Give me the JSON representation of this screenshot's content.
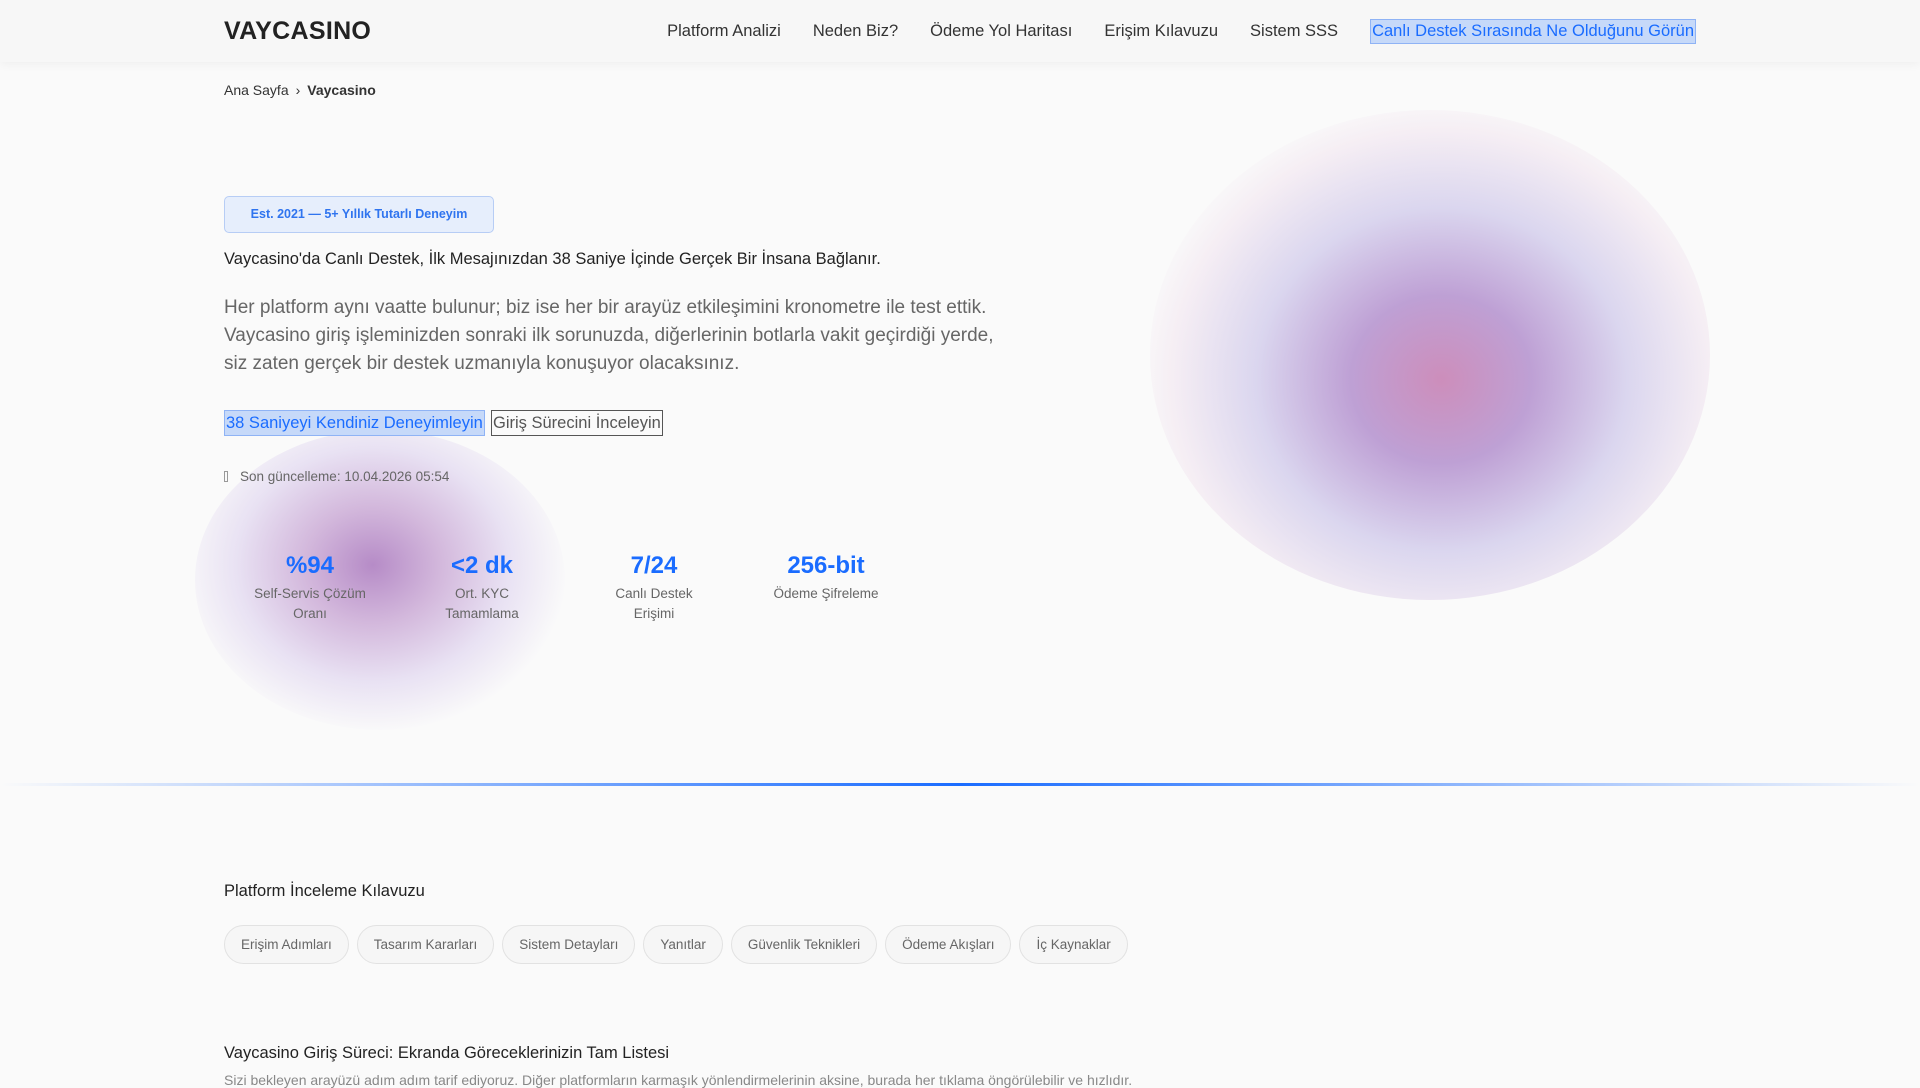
{
  "header": {
    "logo": "VAYCASINO",
    "nav": [
      "Platform Analizi",
      "Neden Biz?",
      "Ödeme Yol Haritası",
      "Erişim Kılavuzu",
      "Sistem SSS"
    ],
    "cta": "Canlı Destek Sırasında Ne Olduğunu Görün"
  },
  "breadcrumb": {
    "home": "Ana Sayfa",
    "separator": "›",
    "current": "Vaycasino"
  },
  "hero": {
    "badge": "Est. 2021 — 5+ Yıllık Tutarlı Deneyim",
    "title": "Vaycasino'da Canlı Destek, İlk Mesajınızdan 38 Saniye İçinde Gerçek Bir İnsana Bağlanır.",
    "lead": "Her platform aynı vaatte bulunur; biz ise her bir arayüz etkileşimini kronometre ile test ettik. Vaycasino giriş işleminizden sonraki ilk sorunuzda, diğerlerinin botlarla vakit geçirdiği yerde, siz zaten gerçek bir destek uzmanıyla konuşuyor olacaksınız.",
    "primary_button": "38 Saniyeyi Kendiniz Deneyimleyin",
    "secondary_button": "Giriş Sürecini İnceleyin",
    "updated": "Son güncelleme: 10.04.2026 05:54"
  },
  "stats": [
    {
      "value": "%94",
      "label": "Self-Servis Çözüm Oranı"
    },
    {
      "value": "<2 dk",
      "label": "Ort. KYC Tamamlama"
    },
    {
      "value": "7/24",
      "label": "Canlı Destek Erişimi"
    },
    {
      "value": "256-bit",
      "label": "Ödeme Şifreleme"
    }
  ],
  "guide": {
    "title": "Platform İnceleme Kılavuzu",
    "chips": [
      "Erişim Adımları",
      "Tasarım Kararları",
      "Sistem Detayları",
      "Yanıtlar",
      "Güvenlik Teknikleri",
      "Ödeme Akışları",
      "İç Kaynaklar"
    ]
  },
  "process": {
    "title": "Vaycasino Giriş Süreci: Ekranda Göreceklerinizin Tam Listesi",
    "text": "Sizi bekleyen arayüzü adım adım tarif ediyoruz. Diğer platformların karmaşık yönlendirmelerinin aksine, burada her tıklama öngörülebilir ve hızlıdır."
  },
  "colors": {
    "accent": "#1a6cff"
  }
}
